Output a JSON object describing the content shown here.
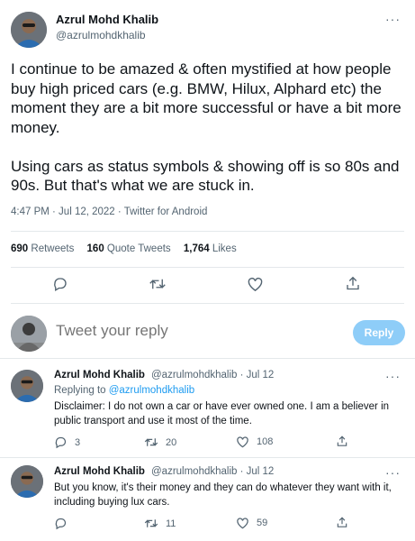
{
  "main_tweet": {
    "author_name": "Azrul Mohd Khalib",
    "author_handle": "@azrulmohdkhalib",
    "text": "I continue to be amazed & often mystified at how people buy high priced cars (e.g. BMW, Hilux, Alphard etc) the moment they are a bit more successful or have a bit more money.\n\nUsing cars as status symbols & showing off is so 80s and 90s. But that's what we are stuck in.",
    "timestamp": "4:47 PM · Jul 12, 2022 · Twitter for Android",
    "stats": {
      "retweets_count": "690",
      "retweets_label": "Retweets",
      "quote_count": "160",
      "quote_label": "Quote Tweets",
      "likes_count": "1,764",
      "likes_label": "Likes"
    }
  },
  "reply_box": {
    "placeholder": "Tweet your reply",
    "button_label": "Reply"
  },
  "replies": [
    {
      "author_name": "Azrul Mohd Khalib",
      "author_handle": "@azrulmohdkhalib · Jul 12",
      "replying_prefix": "Replying to ",
      "replying_handle": "@azrulmohdkhalib",
      "text": "Disclaimer: I do not own a car or have ever owned one. I am a believer in public transport and use it most of the time.",
      "reply_count": "3",
      "retweet_count": "20",
      "like_count": "108"
    },
    {
      "author_name": "Azrul Mohd Khalib",
      "author_handle": "@azrulmohdkhalib · Jul 12",
      "text": "But you know, it's their money and they can do whatever they want with it, including buying lux cars.",
      "reply_count": "",
      "retweet_count": "11",
      "like_count": "59"
    }
  ],
  "icons": {
    "more": "···",
    "reply": "reply-icon",
    "retweet": "retweet-icon",
    "like": "heart-icon",
    "share": "share-icon"
  },
  "colors": {
    "link": "#1d9bf0",
    "reply_button": "#8ecdf8",
    "secondary_text": "#536471"
  }
}
